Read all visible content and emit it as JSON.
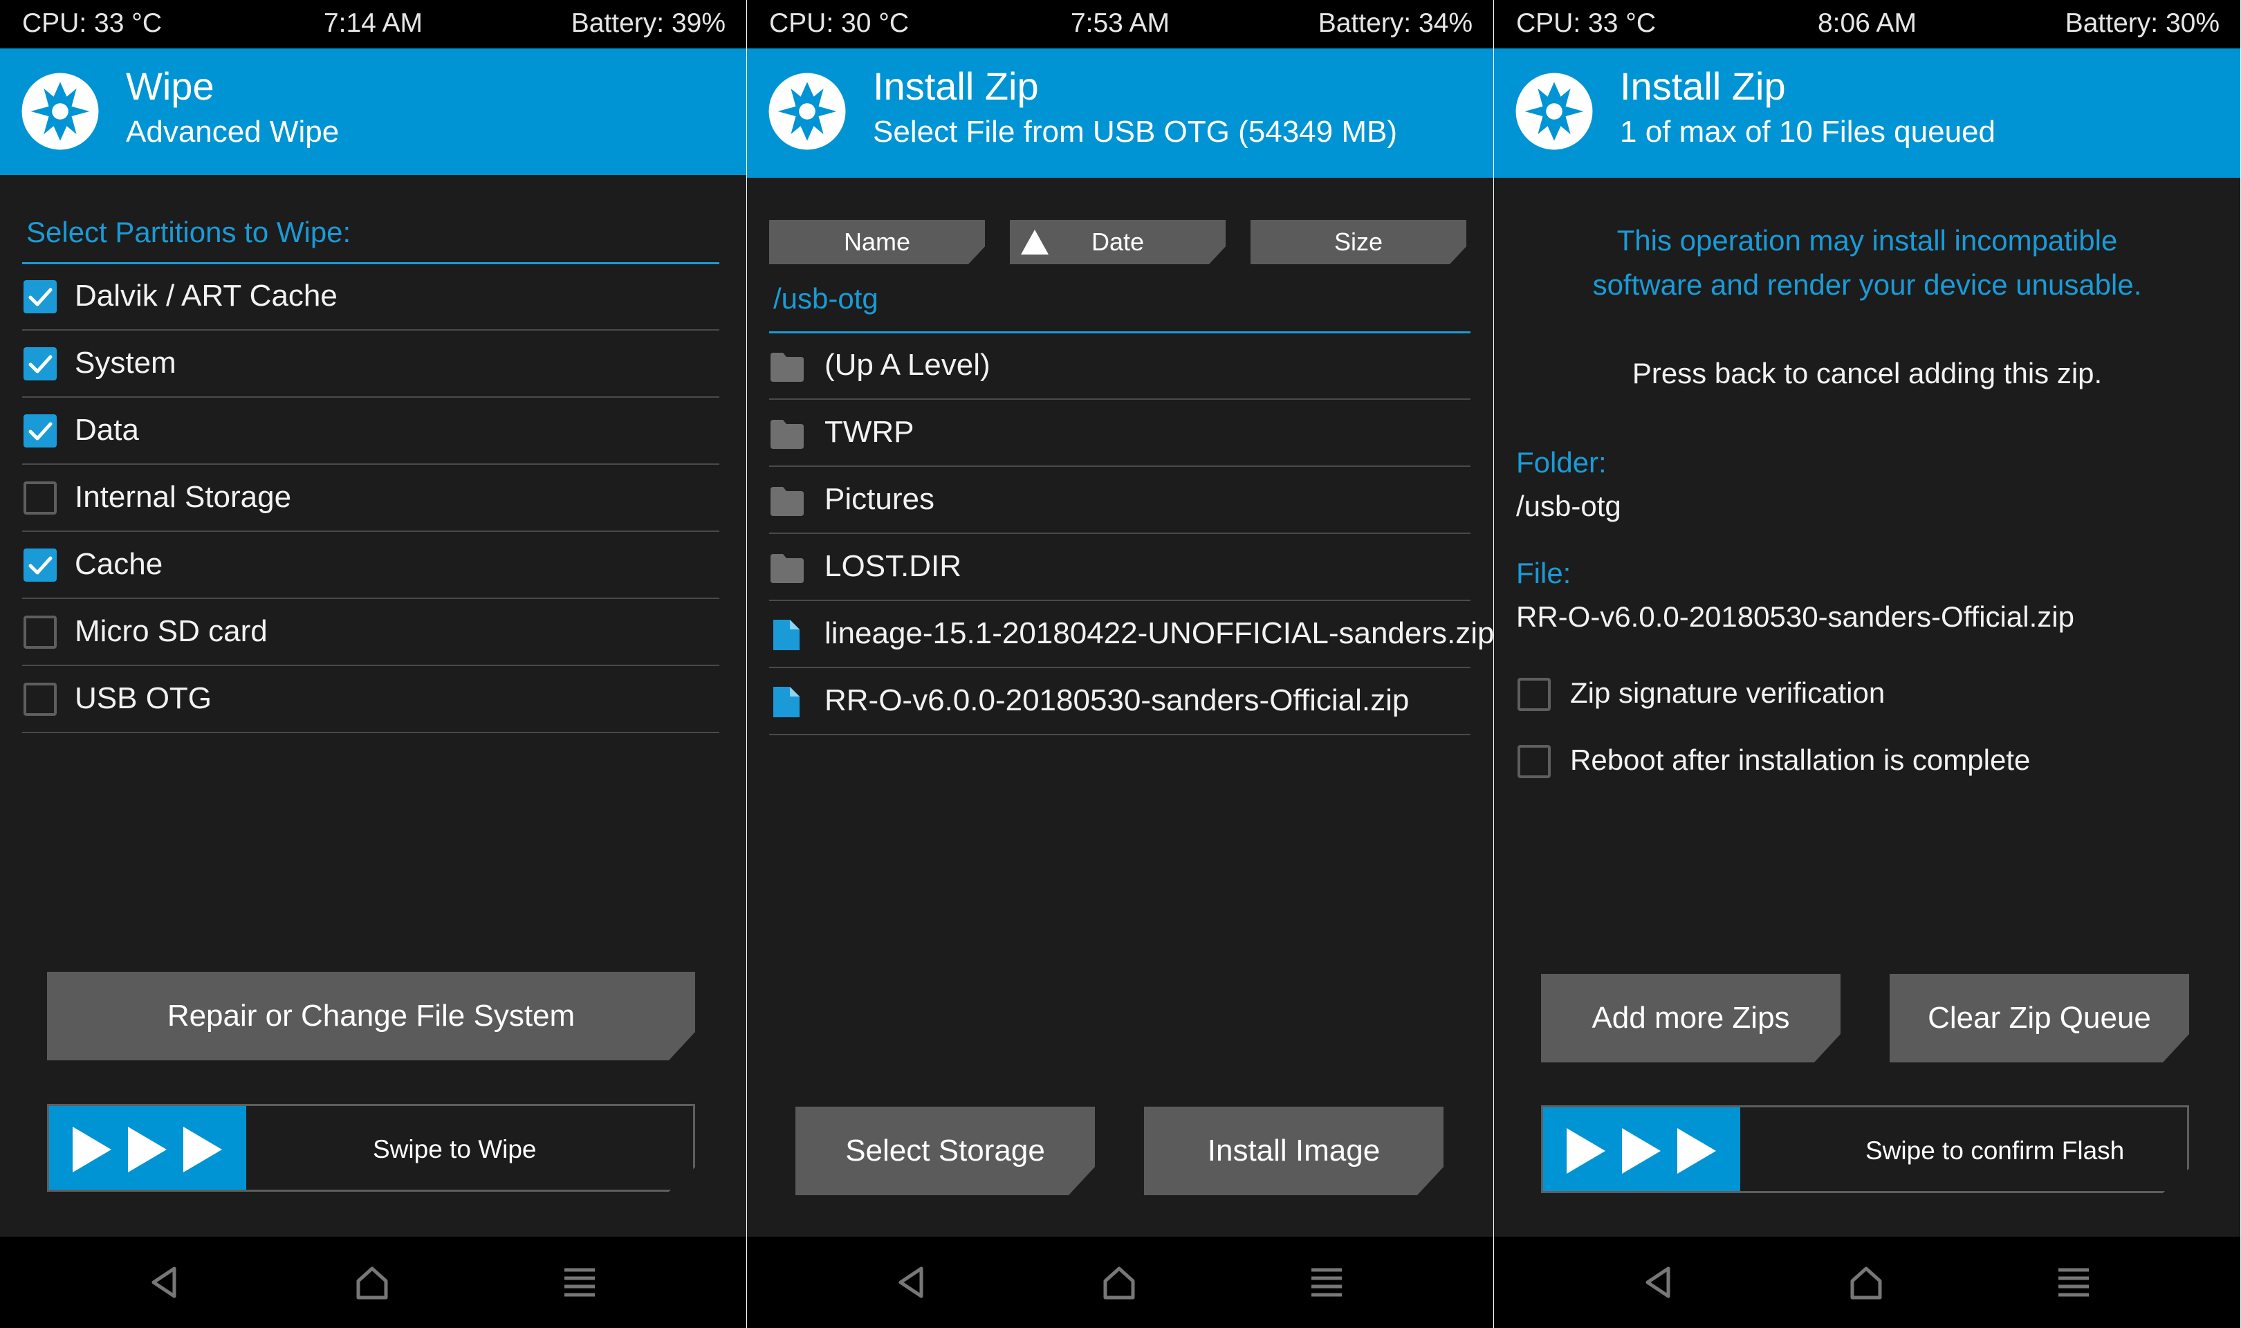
{
  "colors": {
    "accent": "#0094d4",
    "accent_text": "#1a9bd7",
    "background": "#1c1c1c",
    "button": "#5b5b5b",
    "status_bar": "#000000"
  },
  "screens": [
    {
      "status": {
        "cpu": "CPU: 33 °C",
        "time": "7:14 AM",
        "battery": "Battery: 39%"
      },
      "header": {
        "title": "Wipe",
        "subtitle": "Advanced Wipe"
      },
      "section_label": "Select Partitions to Wipe:",
      "partitions": [
        {
          "label": "Dalvik / ART Cache",
          "checked": true
        },
        {
          "label": "System",
          "checked": true
        },
        {
          "label": "Data",
          "checked": true
        },
        {
          "label": "Internal Storage",
          "checked": false
        },
        {
          "label": "Cache",
          "checked": true
        },
        {
          "label": "Micro SD card",
          "checked": false
        },
        {
          "label": "USB OTG",
          "checked": false
        }
      ],
      "repair_button": "Repair or Change File System",
      "swipe_label": "Swipe to Wipe"
    },
    {
      "status": {
        "cpu": "CPU: 30 °C",
        "time": "7:53 AM",
        "battery": "Battery: 34%"
      },
      "header": {
        "title": "Install Zip",
        "subtitle": "Select File from USB OTG (54349 MB)"
      },
      "sort": {
        "name": "Name",
        "date": "Date",
        "size": "Size",
        "active": "date"
      },
      "path": "/usb-otg",
      "files": [
        {
          "label": "(Up A Level)",
          "icon": "folder-icon"
        },
        {
          "label": "TWRP",
          "icon": "folder-icon"
        },
        {
          "label": "Pictures",
          "icon": "folder-icon"
        },
        {
          "label": "LOST.DIR",
          "icon": "folder-icon"
        },
        {
          "label": "lineage-15.1-20180422-UNOFFICIAL-sanders.zip",
          "icon": "file-icon"
        },
        {
          "label": "RR-O-v6.0.0-20180530-sanders-Official.zip",
          "icon": "file-icon"
        }
      ],
      "select_storage_button": "Select Storage",
      "install_image_button": "Install Image"
    },
    {
      "status": {
        "cpu": "CPU: 33 °C",
        "time": "8:06 AM",
        "battery": "Battery: 30%"
      },
      "header": {
        "title": "Install Zip",
        "subtitle": "1 of max of 10 Files queued"
      },
      "warning_line1": "This operation may install incompatible",
      "warning_line2": "software and render your device unusable.",
      "cancel_hint": "Press back to cancel adding this zip.",
      "folder_label": "Folder:",
      "folder_value": "/usb-otg",
      "file_label": "File:",
      "file_value": "RR-O-v6.0.0-20180530-sanders-Official.zip",
      "options": [
        {
          "label": "Zip signature verification",
          "checked": false
        },
        {
          "label": "Reboot after installation is complete",
          "checked": false
        }
      ],
      "add_more_button": "Add more Zips",
      "clear_queue_button": "Clear Zip Queue",
      "swipe_label": "Swipe to confirm Flash"
    }
  ],
  "nav_icons": [
    "back-icon",
    "home-icon",
    "menu-icon"
  ]
}
